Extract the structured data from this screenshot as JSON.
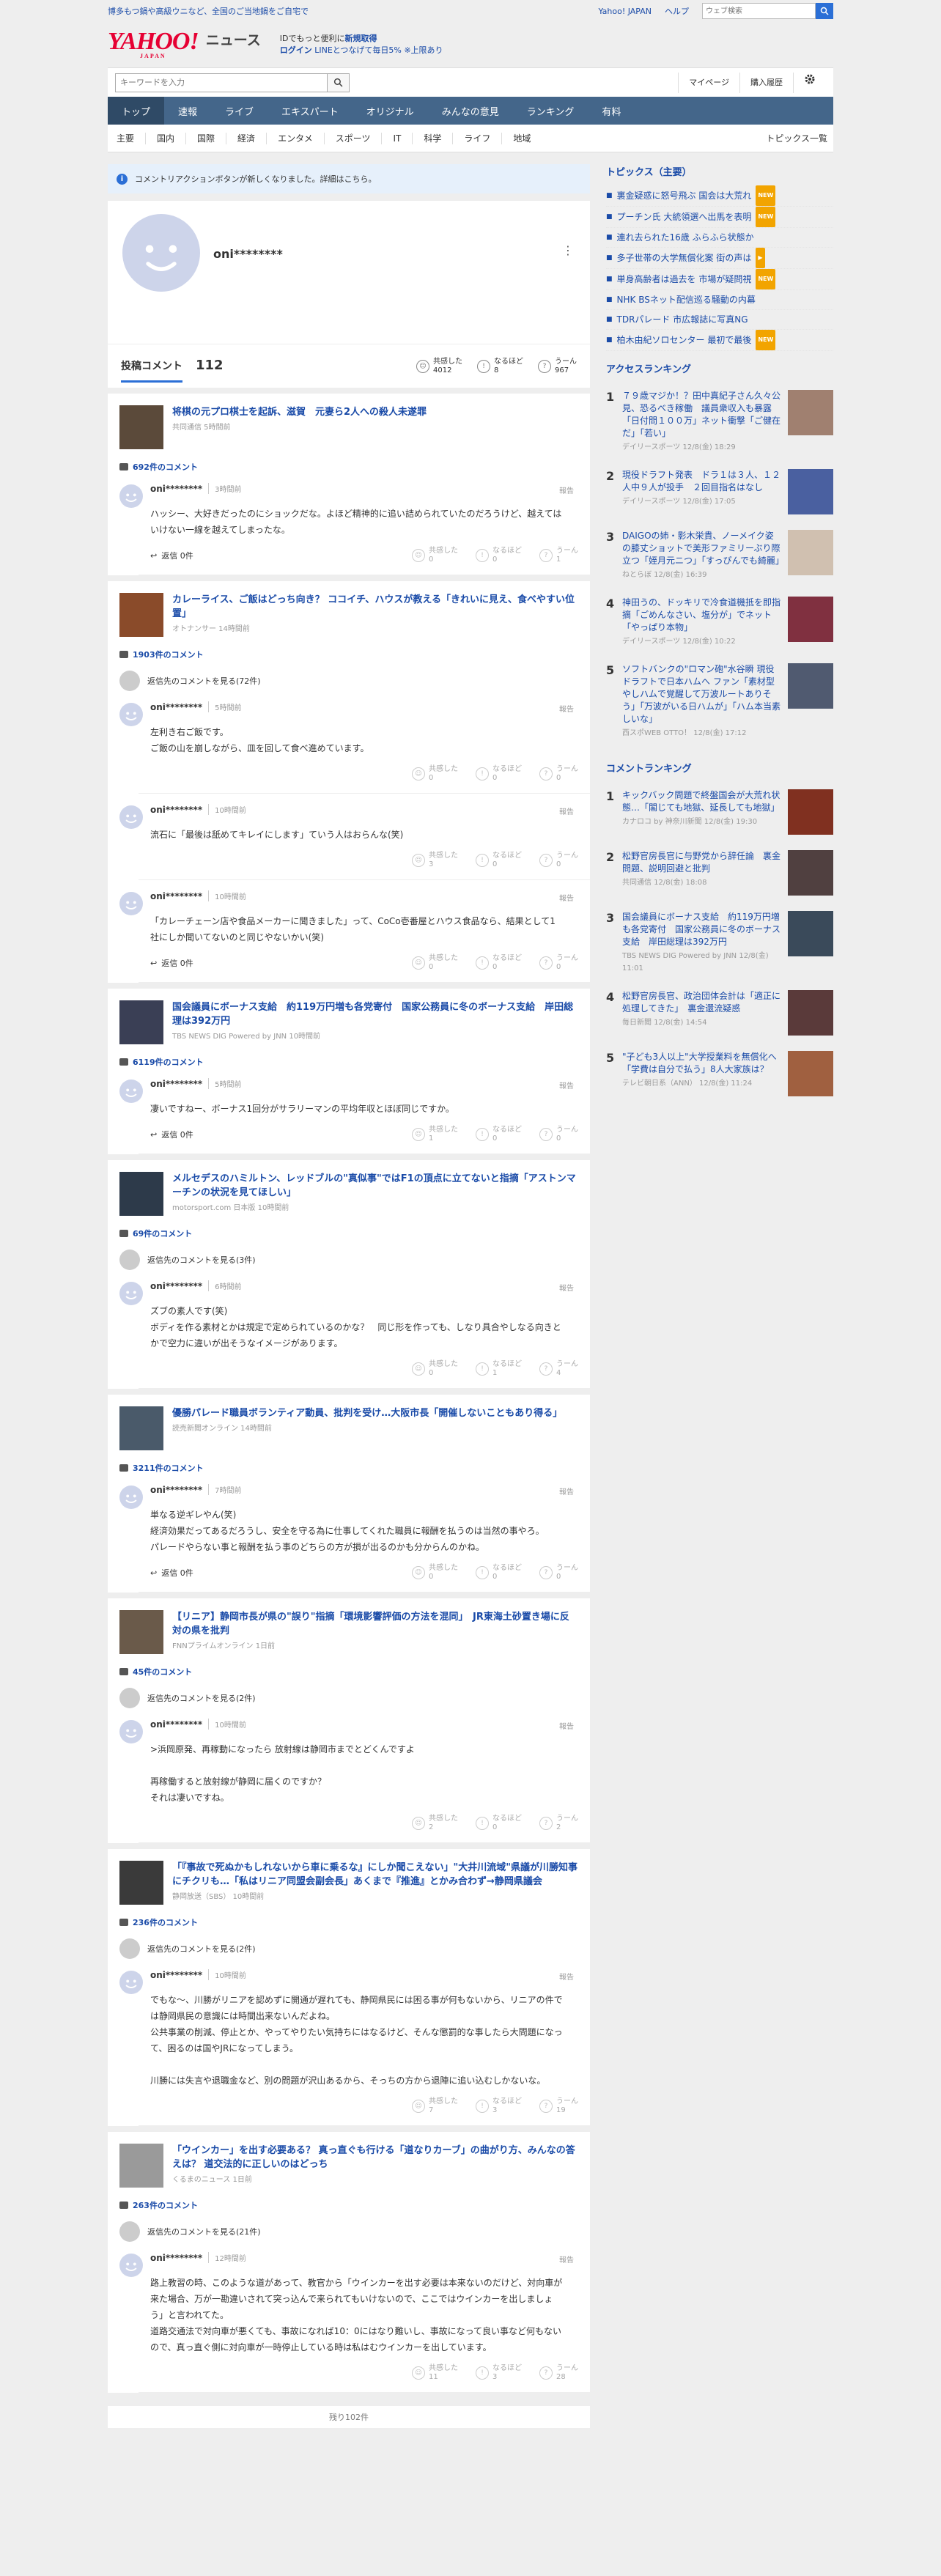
{
  "topbar": {
    "promo": "博多もつ鍋や高級ウニなど、全国のご当地鍋をご自宅で",
    "links": [
      "Yahoo! JAPAN",
      "ヘルプ"
    ],
    "search_placeholder": "ウェブ検索"
  },
  "logo": {
    "brand": "YAHOO!",
    "sub": "JAPAN",
    "service": "ニュース"
  },
  "header_promo": {
    "line1": "IDでもっと便利に",
    "line1_b": "新規取得",
    "line2_a": "ログイン",
    "line2_b": "LINEとつなげて毎日5% ※上限あり"
  },
  "search": {
    "placeholder": "キーワードを入力",
    "links": [
      "マイページ",
      "購入履歴"
    ]
  },
  "nav": [
    "トップ",
    "速報",
    "ライブ",
    "エキスパート",
    "オリジナル",
    "みんなの意見",
    "ランキング",
    "有料"
  ],
  "subnav": {
    "items": [
      "主要",
      "国内",
      "国際",
      "経済",
      "エンタメ",
      "スポーツ",
      "IT",
      "科学",
      "ライフ",
      "地域"
    ],
    "right": "トピックス一覧"
  },
  "notice": "コメントリアクションボタンが新しくなりました。詳細はこちら。",
  "profile": {
    "name": "oni********",
    "stat_label": "投稿コメント",
    "stat_count": "112",
    "reacts": [
      {
        "label": "共感した",
        "value": "4012"
      },
      {
        "label": "なるほど",
        "value": "8"
      },
      {
        "label": "うーん",
        "value": "967"
      }
    ]
  },
  "react_labels": [
    "共感した",
    "なるほど",
    "うーん"
  ],
  "reply_label": "返信",
  "report_label": "報告",
  "user": "oni********",
  "articles": [
    {
      "title": "将棋の元プロ棋士を起訴、滋賀　元妻ら2人への殺人未遂罪",
      "source": "共同通信  5時間前",
      "count": "692件のコメント",
      "comments": [
        {
          "time": "3時間前",
          "text": "ハッシー、大好きだったのにショックだな。よほど精神的に追い詰められていたのだろうけど、越えてはいけない一線を越えてしまったな。",
          "reply": "返信 0件",
          "r": [
            "0",
            "0",
            "1"
          ]
        }
      ]
    },
    {
      "title": "カレーライス、ご飯はどっち向き？ ココイチ、ハウスが教える「きれいに見え、食べやすい位置」",
      "source": "オトナンサー  14時間前",
      "count": "1903件のコメント",
      "thread": "返信先のコメントを見る(72件)",
      "comments": [
        {
          "time": "5時間前",
          "text": "左利き右ご飯です。\nご飯の山を崩しながら、皿を回して食べ進めています。",
          "r": [
            "0",
            "0",
            "0"
          ],
          "nested": true
        },
        {
          "time": "10時間前",
          "text": "流石に「最後は舐めてキレイにします」ていう人はおらんな(笑)",
          "r": [
            "3",
            "0",
            "0"
          ],
          "nested": true
        },
        {
          "time": "10時間前",
          "text": "「カレーチェーン店や食品メーカーに聞きました」って、CoCo壱番屋とハウス食品なら、結果として1社にしか聞いてないのと同じやないかい(笑)",
          "reply": "返信 0件",
          "r": [
            "0",
            "0",
            "0"
          ]
        }
      ]
    },
    {
      "title": "国会議員にボーナス支給　約119万円増も各党寄付　国家公務員に冬のボーナス支給　岸田総理は392万円",
      "source": "TBS NEWS DIG Powered by JNN  10時間前",
      "count": "6119件のコメント",
      "comments": [
        {
          "time": "5時間前",
          "text": "凄いですねー、ボーナス1回分がサラリーマンの平均年収とほぼ同じですか。",
          "reply": "返信 0件",
          "r": [
            "1",
            "0",
            "0"
          ]
        }
      ]
    },
    {
      "title": "メルセデスのハミルトン、レッドブルの\"真似事\"ではF1の頂点に立てないと指摘「アストンマーチンの状況を見てほしい」",
      "source": "motorsport.com 日本版  10時間前",
      "count": "69件のコメント",
      "thread": "返信先のコメントを見る(3件)",
      "comments": [
        {
          "time": "6時間前",
          "text": "ズブの素人です(笑)\nボディを作る素材とかは規定で定められているのかな？　同じ形を作っても、しなり具合やしなる向きとかで空力に違いが出そうなイメージがあります。",
          "r": [
            "0",
            "1",
            "4"
          ],
          "nested": true
        }
      ]
    },
    {
      "title": "優勝パレード職員ボランティア動員、批判を受け…大阪市長「開催しないこともあり得る」",
      "source": "読売新聞オンライン  14時間前",
      "count": "3211件のコメント",
      "comments": [
        {
          "time": "7時間前",
          "text": "単なる逆ギレやん(笑)\n経済効果だってあるだろうし、安全を守る為に仕事してくれた職員に報酬を払うのは当然の事やろ。\nパレードやらない事と報酬を払う事のどちらの方が損が出るのかも分からんのかね。",
          "reply": "返信 0件",
          "r": [
            "0",
            "0",
            "0"
          ]
        }
      ]
    },
    {
      "title": "【リニア】静岡市長が県の\"誤り\"指摘「環境影響評価の方法を混同」　JR東海土砂置き場に反対の県を批判",
      "source": "FNNプライムオンライン  1日前",
      "count": "45件のコメント",
      "thread": "返信先のコメントを見る(2件)",
      "comments": [
        {
          "time": "10時間前",
          "text": ">浜岡原発、再稼動になったら 放射線は静岡市までとどくんですよ\n\n再稼働すると放射線が静岡に届くのですか？\nそれは凄いですね。",
          "r": [
            "2",
            "0",
            "2"
          ],
          "nested": true
        }
      ]
    },
    {
      "title": "「『事故で死ぬかもしれないから車に乗るな』にしか聞こえない」\"大井川流域\"県議が川勝知事にチクリも…「私はリニア同盟会副会長」あくまで『推進』とかみ合わず→静岡県議会",
      "source": "静岡放送（SBS）  10時間前",
      "count": "236件のコメント",
      "thread": "返信先のコメントを見る(2件)",
      "comments": [
        {
          "time": "10時間前",
          "text": "でもな〜、川勝がリニアを認めずに開通が遅れても、静岡県民には困る事が何もないから、リニアの件では静岡県民の意識には時間出来ないんだよね。\n公共事業の削減、停止とか、やってやりたい気持ちにはなるけど、そんな懲罰的な事したら大問題になって、困るのは国やJRになってしまう。\n\n川勝には失言や退職金など、別の問題が沢山あるから、そっちの方から退陣に追い込むしかないな。",
          "r": [
            "7",
            "3",
            "19"
          ],
          "nested": true
        }
      ]
    },
    {
      "title": "「ウインカー」を出す必要ある？ 真っ直ぐも行ける「道なりカーブ」の曲がり方、みんなの答えは？ 道交法的に正しいのはどっち",
      "source": "くるまのニュース  1日前",
      "count": "263件のコメント",
      "thread": "返信先のコメントを見る(21件)",
      "comments": [
        {
          "time": "12時間前",
          "text": "路上教習の時、このような道があって、教官から「ウインカーを出す必要は本来ないのだけど、対向車が来た場合、万が一勘違いされて突っ込んで来られてもいけないので、ここではウインカーを出しましょう」と言われてた。\n道路交通法で対向車が悪くても、事故になれば10：0にはなり難いし、事故になって良い事など何もないので、真っ直ぐ側に対向車が一時停止している時は私はむウインカーを出しています。",
          "r": [
            "11",
            "3",
            "28"
          ],
          "nested": true
        }
      ]
    }
  ],
  "more": "残り102件",
  "topics": {
    "title": "トピックス（主要）",
    "items": [
      {
        "text": "裏金疑惑に怒号飛ぶ 国会は大荒れ",
        "badge": "NEW"
      },
      {
        "text": "プーチン氏 大統領選へ出馬を表明",
        "badge": "NEW"
      },
      {
        "text": "連れ去られた16歳 ふらふら状態か",
        "badge": ""
      },
      {
        "text": "多子世帯の大学無償化案 街の声は",
        "badge": "▶"
      },
      {
        "text": "単身高齢者は過去を 市場が疑問視",
        "badge": "NEW"
      },
      {
        "text": "NHK BSネット配信巡る騒動の内幕",
        "badge": ""
      },
      {
        "text": "TDRパレード 市広報誌に写真NG",
        "badge": ""
      },
      {
        "text": "柏木由紀ソロセンター 最初で最後",
        "badge": "NEW"
      }
    ]
  },
  "access": {
    "title": "アクセスランキング",
    "items": [
      {
        "n": "1",
        "text": "７９歳マジか！？田中真紀子さん久々公見、恐るべき稼働　議員衆収入も暴露「日付問１００万」ネット衝撃「ご健在だ」「若い」",
        "src": "デイリースポーツ  12/8(金) 18:29"
      },
      {
        "n": "2",
        "text": "現役ドラフト発表　ドラ１は３人、１２人中９人が投手　２回目指名はなし",
        "src": "デイリースポーツ  12/8(金) 17:05"
      },
      {
        "n": "3",
        "text": "DAIGOの姉・影木栄貴、ノーメイク姿の膝丈ショットで美形ファミリーぶり際立つ「姪月元ニつ」「すっぴんでも綺麗」",
        "src": "ねとらぼ  12/8(金) 16:39"
      },
      {
        "n": "4",
        "text": "神田うの、ドッキリで冷食道機抵を即指摘「ごめんなさい、塩分が」でネット「やっぱり本物」",
        "src": "デイリースポーツ  12/8(金) 10:22"
      },
      {
        "n": "5",
        "text": "ソフトバンクの\"ロマン砲\"水谷瞬 現役ドラフトで日本ハムへ ファン「素材型やしハムで覚醒して万波ルートありそう」「万波がいる日ハムが」「ハム本当素しいな」",
        "src": "西スポWEB OTTO！  12/8(金) 17:12"
      }
    ]
  },
  "comment_rank": {
    "title": "コメントランキング",
    "items": [
      {
        "n": "1",
        "text": "キックバック問題で終盤国会が大荒れ状態…「閣じても地獄、延長しても地獄」",
        "src": "カナロコ by 神奈川新聞  12/8(金) 19:30"
      },
      {
        "n": "2",
        "text": "松野官房長官に与野党から辞任論　裏金問題、説明回避と批判",
        "src": "共同通信  12/8(金) 18:08"
      },
      {
        "n": "3",
        "text": "国会議員にボーナス支給　約119万円増も各党寄付　国家公務員に冬のボーナス支給　岸田総理は392万円",
        "src": "TBS NEWS DIG Powered by JNN  12/8(金) 11:01"
      },
      {
        "n": "4",
        "text": "松野官房長官、政治団体会計は「適正に処理してきた」　裏金還流疑惑",
        "src": "毎日新聞  12/8(金) 14:54"
      },
      {
        "n": "5",
        "text": "\"子ども3人以上\"大学授業料を無償化へ　「学費は自分で払う」8人大家族は？",
        "src": "テレビ朝日系（ANN）  12/8(金) 11:24"
      }
    ]
  },
  "colors": {
    "nav": "#44668a",
    "nav_active": "#2f4a66",
    "link": "#1a4ba8",
    "accent": "#2b6fd6",
    "logo": "#e60033",
    "new_badge": "#f2a400"
  }
}
